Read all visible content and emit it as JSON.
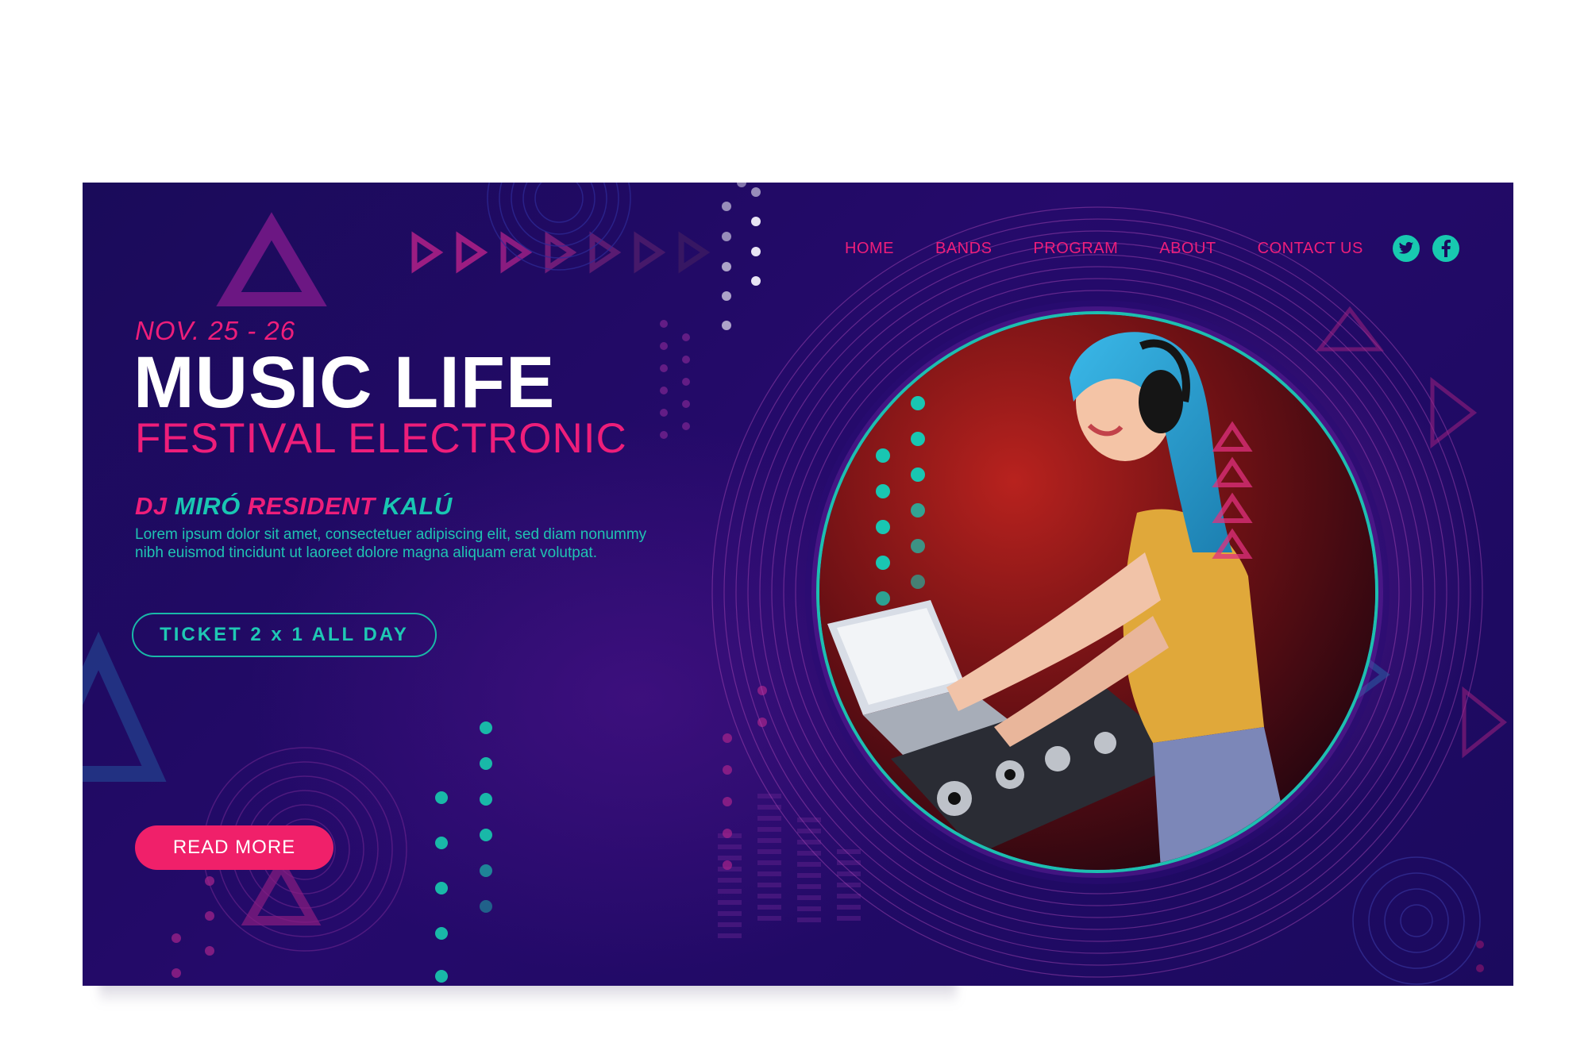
{
  "nav": {
    "items": [
      {
        "label": "HOME"
      },
      {
        "label": "BANDS"
      },
      {
        "label": "PROGRAM"
      },
      {
        "label": "ABOUT"
      },
      {
        "label": "CONTACT US"
      }
    ],
    "socials": [
      {
        "icon": "twitter-icon"
      },
      {
        "icon": "facebook-icon"
      }
    ]
  },
  "hero": {
    "date": "NOV. 25 - 26",
    "title": "MUSIC LIFE",
    "subtitle": "FESTIVAL ELECTRONIC",
    "dj_line_part1": "DJ ",
    "dj_line_part2": "MIRÓ",
    "dj_line_part3": " RESIDENT ",
    "dj_line_part4": "KALÚ",
    "body": "Lorem ipsum dolor sit amet, consectetuer adipiscing elit, sed diam nonummy nibh euismod tincidunt ut laoreet dolore magna aliquam erat volutpat.",
    "ticket_button": "TICKET 2 x 1 ALL DAY",
    "read_more_button": "READ MORE"
  },
  "colors": {
    "background": "#1b0a5e",
    "pink": "#ee1e7a",
    "teal": "#19c6b2",
    "white": "#ffffff"
  }
}
